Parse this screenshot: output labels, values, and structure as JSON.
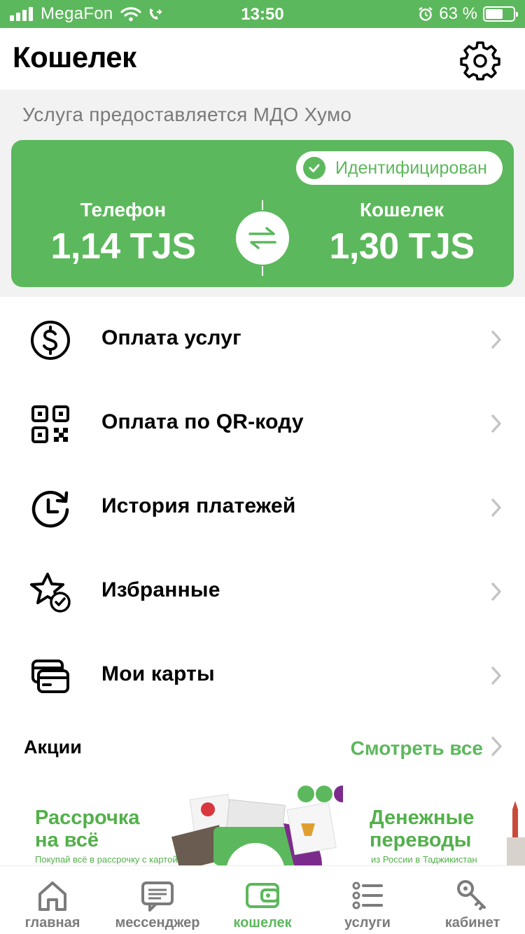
{
  "status_bar": {
    "carrier": "MegaFon",
    "time": "13:50",
    "battery_percent": "63 %",
    "battery_level": 0.63
  },
  "header": {
    "title": "Кошелек",
    "settings_icon": "gear-icon"
  },
  "wallet": {
    "provider_text": "Услуга предоставляется МДО Хумо",
    "identified_label": "Идентифицирован",
    "phone_label": "Телефон",
    "phone_balance": "1,14 TJS",
    "wallet_label": "Кошелек",
    "wallet_balance": "1,30 TJS",
    "swap_icon": "swap-arrows-icon"
  },
  "menu": [
    {
      "label": "Оплата услуг",
      "icon": "dollar-circle-icon"
    },
    {
      "label": "Оплата по QR-коду",
      "icon": "qr-code-icon"
    },
    {
      "label": "История платежей",
      "icon": "history-clock-icon"
    },
    {
      "label": "Избранные",
      "icon": "star-check-icon"
    },
    {
      "label": "Мои карты",
      "icon": "cards-icon"
    }
  ],
  "promos": {
    "title": "Акции",
    "see_all": "Смотреть все",
    "items": [
      {
        "title_line1": "Рассрочка",
        "title_line2": "на всё",
        "subtitle": "Покупай всё в рассрочку с картой"
      },
      {
        "title_line1": "Денежные",
        "title_line2": "переводы",
        "subtitle": "из России в Таджикистан"
      }
    ]
  },
  "tabbar": {
    "active": "кошелек",
    "tabs": [
      {
        "label": "главная",
        "icon": "home-icon"
      },
      {
        "label": "мессенджер",
        "icon": "chat-icon"
      },
      {
        "label": "кошелек",
        "icon": "wallet-icon"
      },
      {
        "label": "услуги",
        "icon": "services-list-icon"
      },
      {
        "label": "кабинет",
        "icon": "key-icon"
      }
    ]
  },
  "colors": {
    "brand_green": "#5cb85c",
    "text_gray": "#7a7a7a",
    "section_bg": "#f2f2f2",
    "promo_purple": "#7b2b8c"
  }
}
